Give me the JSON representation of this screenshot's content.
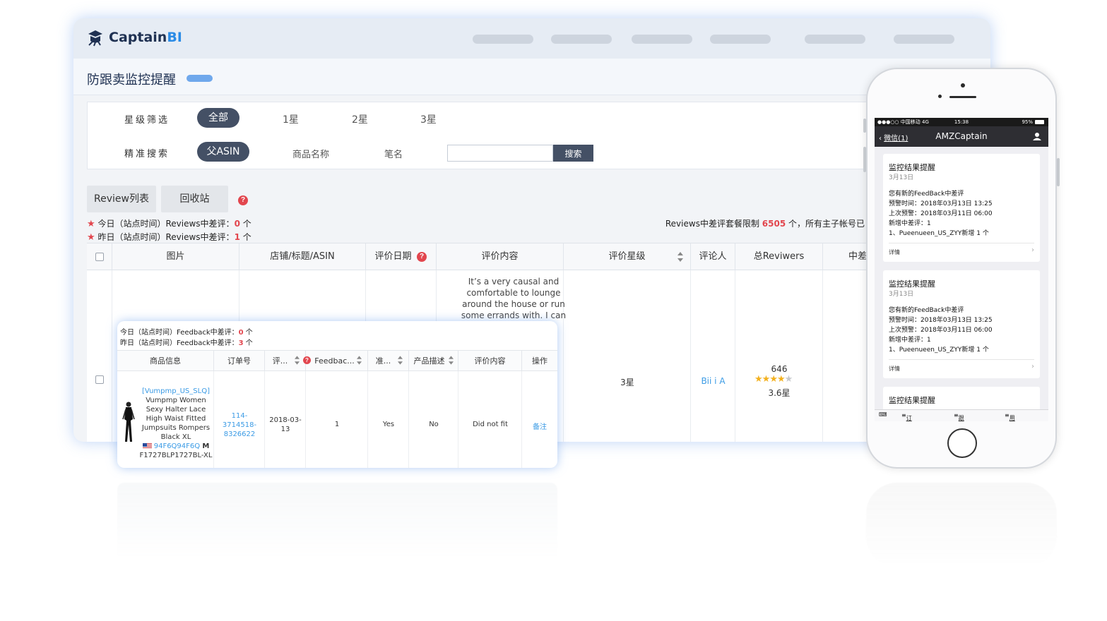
{
  "app": {
    "logo_main": "Captain",
    "logo_accent": "BI",
    "page_title": "防跟卖监控提醒"
  },
  "filters": {
    "star_label": "星级筛选",
    "star_options": [
      "全部",
      "1星",
      "2星",
      "3星"
    ],
    "search_label": "精准搜索",
    "search_options": [
      "父ASIN",
      "商品名称",
      "笔名"
    ],
    "search_input_value": "",
    "search_button": "搜索"
  },
  "tabs": [
    "Review列表",
    "回收站"
  ],
  "stats": {
    "today_prefix": "今日（站点时间）Reviews中差评：",
    "today_count": "0",
    "yesterday_prefix": "昨日（站点时间）Reviews中差评：",
    "yesterday_count": "1",
    "unit": " 个",
    "limit_prefix": "Reviews中差评套餐限制 ",
    "limit_value": "6505",
    "limit_suffix": " 个，所有主子帐号已"
  },
  "table": {
    "headers": [
      "图片",
      "店铺/标题/ASIN",
      "评价日期",
      "评价内容",
      "评价星级",
      "评论人",
      "总Reviwers",
      "中差"
    ],
    "row": {
      "review_text": "It’s a very causal and comfortable to lounge around the house or run some errands with. I can",
      "star_level": "3星",
      "reviewer": "Bii i A",
      "total_reviews": "646",
      "rating_text": "3.6星",
      "rating": 3.6
    }
  },
  "feedback_card": {
    "today_prefix": "今日（站点时间）Feedback中差评：",
    "today_count": "0",
    "yesterday_prefix": "昨日（站点时间）Feedback中差评：",
    "yesterday_count": "3",
    "unit": " 个",
    "headers": [
      "商品信息",
      "订单号",
      "评...",
      "Feedbac...",
      "准...",
      "产品描述",
      "评价内容",
      "操作"
    ],
    "row": {
      "store": "[Vumpmp_US_SLQ]",
      "title": "Vumpmp Women Sexy Halter Lace High Waist Fitted Jumpsuits Rompers Black XL",
      "asin": "94F6Q94F6Q",
      "size_tag": "M",
      "sku": "F1727BLP1727BL-XL",
      "order_id": "114-3714518-8326622",
      "date": "2018-03-13",
      "feedback": "1",
      "accurate": "Yes",
      "description": "No",
      "content": "Did not fit",
      "action": "备注"
    }
  },
  "phone": {
    "status_left": "●●●○○ 中国移动  4G",
    "status_time": "15:38",
    "status_right": "95%",
    "back_label": "微信(1)",
    "chat_title": "AMZCaptain",
    "messages": [
      {
        "title": "监控结果提醒",
        "date": "3月13日",
        "lines": [
          "您有新的FeedBack中差评",
          "预警时间：2018年03月13日 13:25",
          "上次预警：2018年03月11日 06:00",
          "新增中差评：1",
          "1、Pueenueen_US_ZYY新增 1 个"
        ],
        "detail": "详情"
      },
      {
        "title": "监控结果提醒",
        "date": "3月13日",
        "lines": [
          "您有新的FeedBack中差评",
          "预警时间：2018年03月13日 13:25",
          "上次预警：2018年03月11日 06:00",
          "新增中差评：1",
          "1、Pueenueen_US_ZYY新增 1 个"
        ],
        "detail": "详情"
      },
      {
        "title": "监控结果提醒"
      }
    ],
    "menu": [
      "订单|邮件",
      "跟卖工具",
      "用户中心"
    ]
  },
  "colors": {
    "brand_dark": "#1f3152",
    "brand_accent": "#2a8be6",
    "chip": "#445065",
    "alert_red": "#e2464e",
    "link_blue": "#3b9be5",
    "star_gold": "#f3b11f"
  }
}
